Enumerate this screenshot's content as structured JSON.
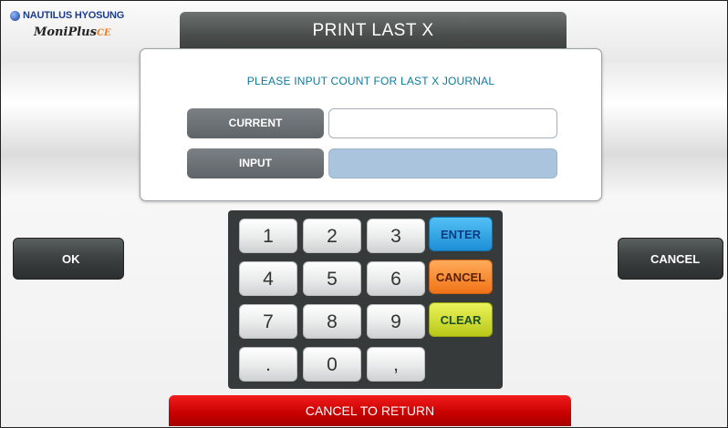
{
  "brand": {
    "company": "NAUTILUS HYOSUNG",
    "product": "MoniPlus",
    "product_suffix": "CE"
  },
  "title": "PRINT LAST X",
  "dialog": {
    "prompt": "PLEASE INPUT COUNT FOR LAST X JOURNAL",
    "current_label": "CURRENT",
    "current_value": "",
    "input_label": "INPUT",
    "input_value": ""
  },
  "side_buttons": {
    "ok": "OK",
    "cancel": "CANCEL"
  },
  "keypad": {
    "digits": [
      "1",
      "2",
      "3",
      "4",
      "5",
      "6",
      "7",
      "8",
      "9",
      ".",
      "0",
      ","
    ],
    "enter": "ENTER",
    "cancel": "CANCEL",
    "clear": "CLEAR"
  },
  "bottom_button": "CANCEL TO RETURN",
  "colors": {
    "accent_blue": "#1d8fd6",
    "accent_orange": "#f07317",
    "accent_yellow": "#b9c818",
    "return_red": "#c70000",
    "prompt_text": "#0e7a9a"
  }
}
